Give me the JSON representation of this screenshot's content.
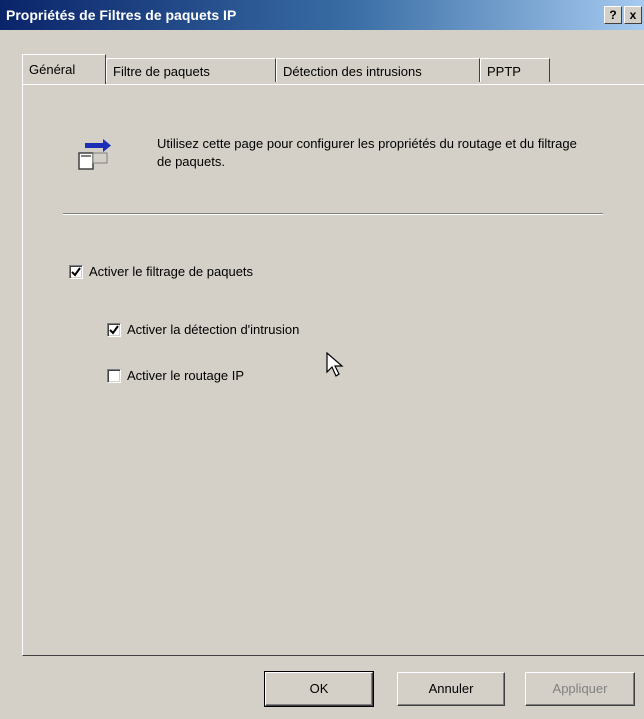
{
  "window": {
    "title": "Propriétés de Filtres de paquets IP",
    "help_button": "?",
    "close_button": "x"
  },
  "tabs": [
    {
      "label": "Général",
      "active": true
    },
    {
      "label": "Filtre de paquets",
      "active": false
    },
    {
      "label": "Détection des intrusions",
      "active": false
    },
    {
      "label": "PPTP",
      "active": false
    }
  ],
  "general": {
    "icon": "routing-properties-icon",
    "description": "Utilisez cette page pour configurer les propriétés du routage et du filtrage de paquets.",
    "checkboxes": [
      {
        "label": "Activer le filtrage de paquets",
        "checked": true
      },
      {
        "label": "Activer la détection d'intrusion",
        "checked": true
      },
      {
        "label": "Activer le routage IP",
        "checked": false
      }
    ]
  },
  "buttons": {
    "ok": "OK",
    "cancel": "Annuler",
    "apply": "Appliquer"
  },
  "colors": {
    "titlebar_start": "#0a246a",
    "titlebar_end": "#a6caf0",
    "face": "#d4d0c8"
  }
}
